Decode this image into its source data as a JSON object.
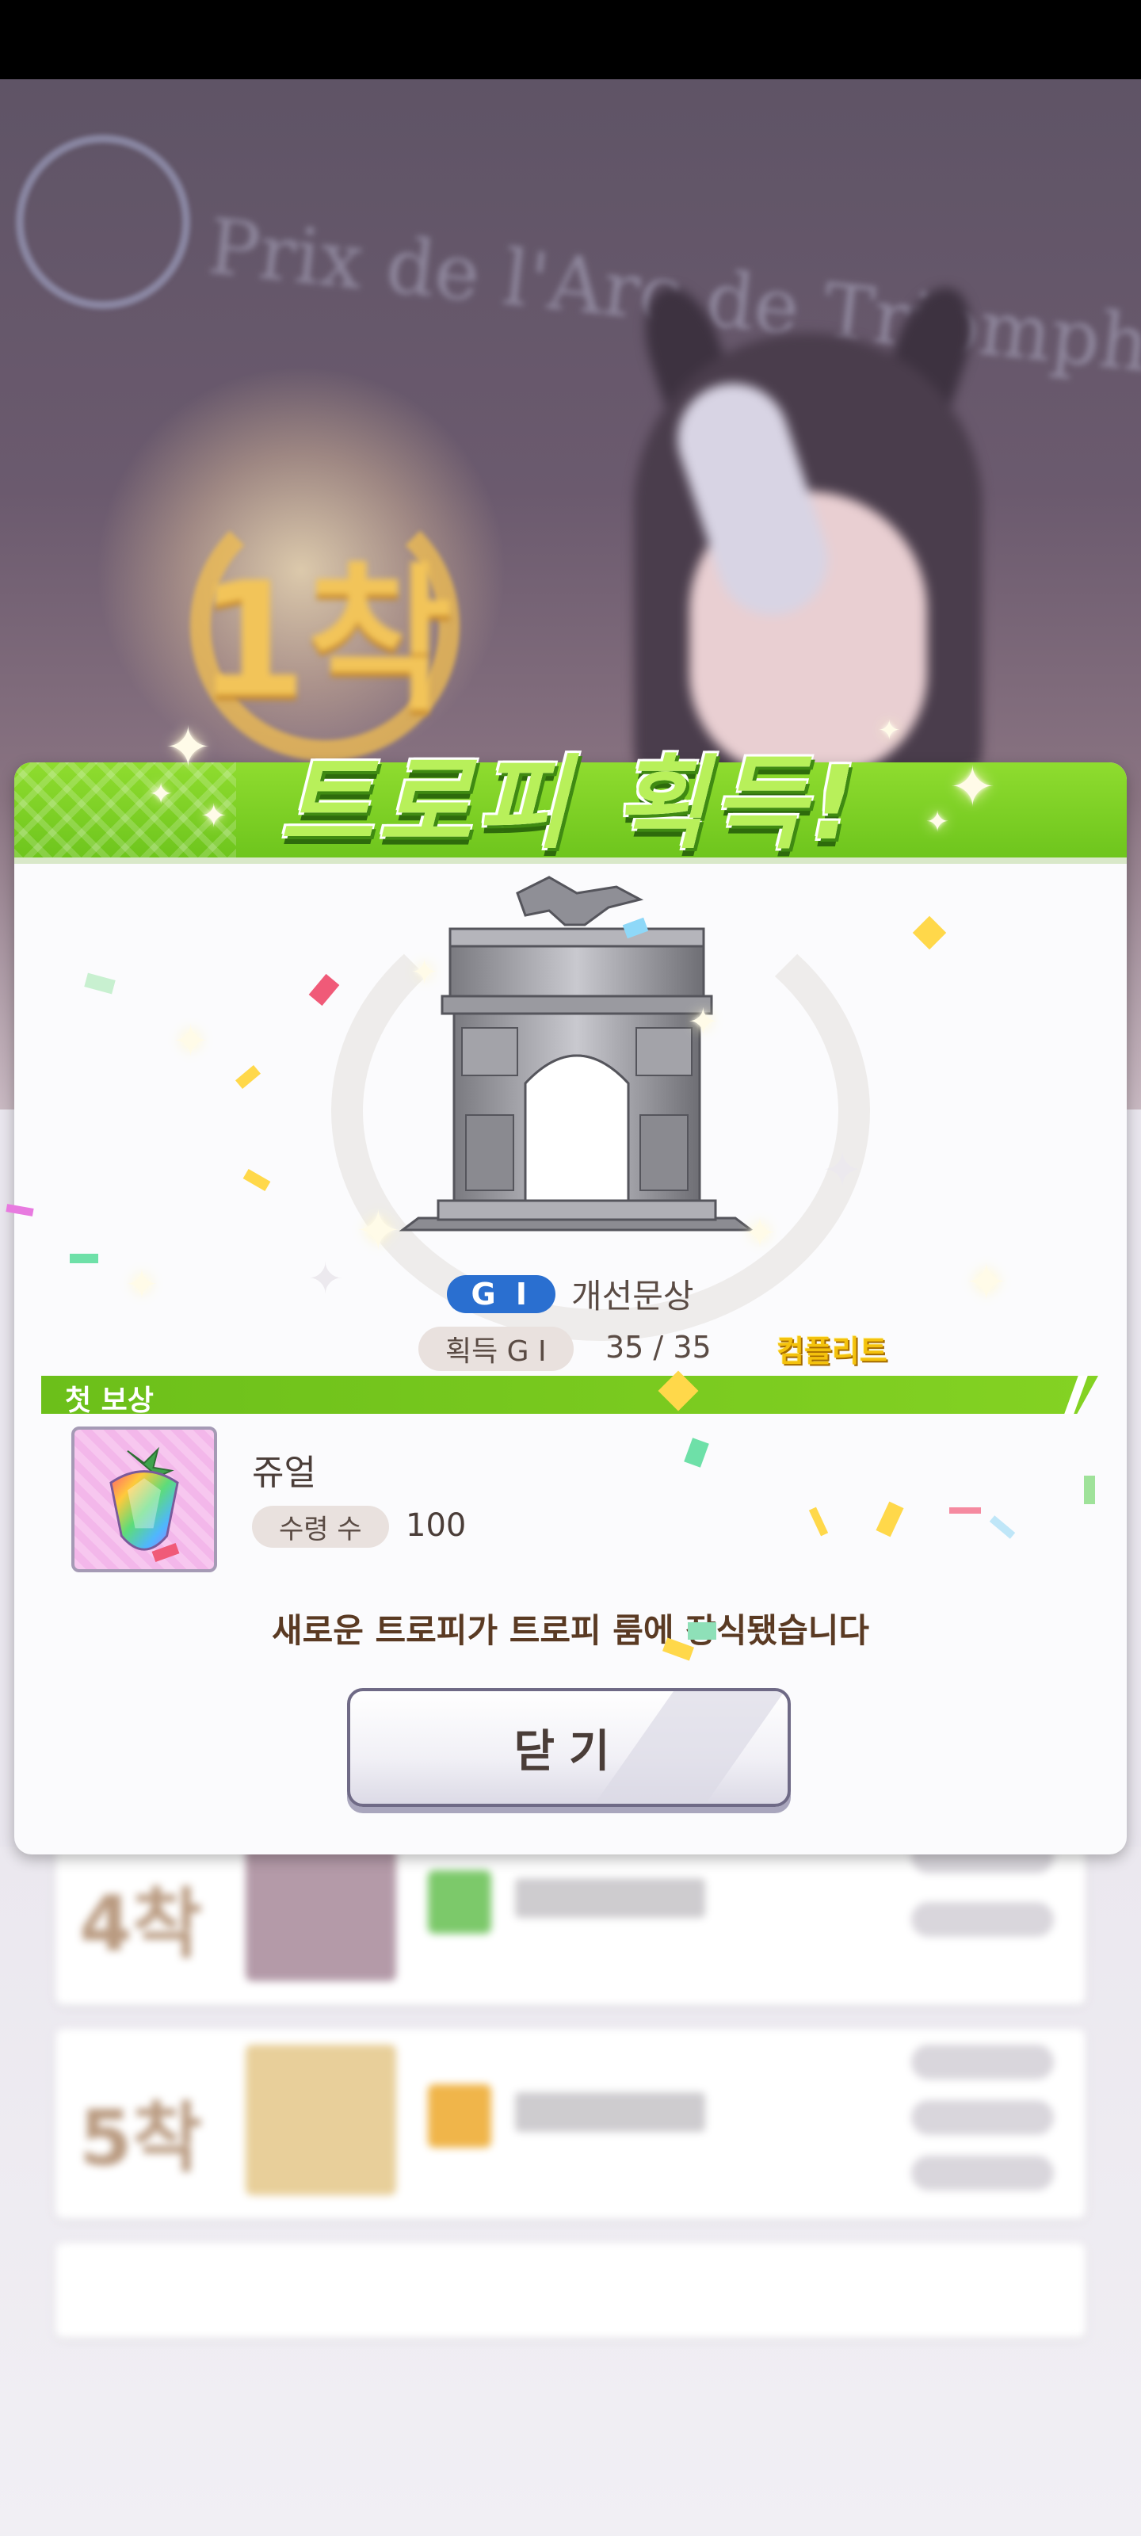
{
  "background": {
    "race_title": "Prix de l'Arc de Triomphe",
    "rank_badge": "1착",
    "lower_places": [
      "4착",
      "5착"
    ]
  },
  "modal": {
    "title": "트로피 획득!",
    "race": {
      "grade": "G I",
      "name": "개선문상",
      "grade_color": "#2a6fd0"
    },
    "progress": {
      "label": "획득 G I",
      "value": "35 / 35",
      "status": "컴플리트"
    },
    "reward_section": {
      "label": "첫 보상",
      "item_name": "쥬얼",
      "qty_label": "수령 수",
      "qty_value": "100",
      "icon": "rainbow-jewel-icon"
    },
    "notice": "새로운 트로피가 트로피 룸에 장식됐습니다",
    "close_label": "닫기",
    "accent_colors": {
      "header_green": "#7ccf25",
      "complete_gold": "#f4c20d"
    }
  }
}
